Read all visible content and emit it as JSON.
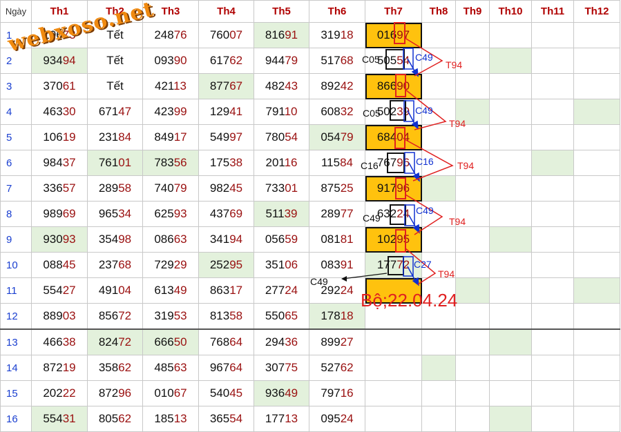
{
  "header": {
    "day": "Ngày",
    "months": [
      "Th1",
      "Th2",
      "Th3",
      "Th4",
      "Th5",
      "Th6",
      "Th7",
      "Th8",
      "Th9",
      "Th10",
      "Th11",
      "Th12"
    ]
  },
  "rows": [
    {
      "day": "1",
      "cells": [
        "10673",
        "Tết",
        "24876",
        "76007",
        "81691",
        "31918",
        "01697",
        "",
        "",
        "",
        "",
        ""
      ],
      "green": [
        4
      ]
    },
    {
      "day": "2",
      "cells": [
        "93494",
        "Tết",
        "09390",
        "61762",
        "94479",
        "51768",
        "50554",
        "",
        "",
        "",
        "",
        ""
      ],
      "green": [
        0,
        9
      ]
    },
    {
      "day": "3",
      "cells": [
        "37061",
        "Tết",
        "42113",
        "87767",
        "48243",
        "89242",
        "86690",
        "",
        "",
        "",
        "",
        ""
      ],
      "green": [
        3
      ]
    },
    {
      "day": "4",
      "cells": [
        "46330",
        "67147",
        "42399",
        "12941",
        "79110",
        "60832",
        "50239",
        "",
        "",
        "",
        "",
        ""
      ],
      "green": [
        8,
        11
      ]
    },
    {
      "day": "5",
      "cells": [
        "10619",
        "23184",
        "84917",
        "54997",
        "78054",
        "05479",
        "68404",
        "",
        "",
        "",
        "",
        ""
      ],
      "green": [
        5
      ]
    },
    {
      "day": "6",
      "cells": [
        "98437",
        "76101",
        "78356",
        "17538",
        "20116",
        "11584",
        "76796",
        "",
        "",
        "",
        "",
        ""
      ],
      "green": [
        1,
        2,
        10
      ]
    },
    {
      "day": "7",
      "cells": [
        "33657",
        "28958",
        "74079",
        "98245",
        "73301",
        "87525",
        "91796",
        "",
        "",
        "",
        "",
        ""
      ],
      "green": [
        7
      ]
    },
    {
      "day": "8",
      "cells": [
        "98969",
        "96534",
        "62593",
        "43769",
        "51139",
        "28977",
        "63224",
        "",
        "",
        "",
        "",
        ""
      ],
      "green": [
        4
      ]
    },
    {
      "day": "9",
      "cells": [
        "93093",
        "35498",
        "08663",
        "34194",
        "05659",
        "08181",
        "10295",
        "",
        "",
        "",
        "",
        ""
      ],
      "green": [
        0,
        9
      ]
    },
    {
      "day": "10",
      "cells": [
        "08845",
        "23768",
        "72929",
        "25295",
        "35106",
        "08391",
        "17772",
        "",
        "",
        "",
        "",
        ""
      ],
      "green": [
        3,
        6
      ]
    },
    {
      "day": "11",
      "cells": [
        "55427",
        "49104",
        "61349",
        "86317",
        "27724",
        "29224",
        "",
        "",
        "",
        "",
        "",
        ""
      ],
      "green": [
        8,
        11
      ]
    },
    {
      "day": "12",
      "cells": [
        "88903",
        "85672",
        "31953",
        "81358",
        "55065",
        "17818",
        "",
        "",
        "",
        "",
        "",
        ""
      ],
      "green": [
        5
      ]
    },
    {
      "day": "13",
      "cells": [
        "46638",
        "82472",
        "66650",
        "76864",
        "29436",
        "89927",
        "",
        "",
        "",
        "",
        "",
        ""
      ],
      "green": [
        1,
        2,
        9
      ]
    },
    {
      "day": "14",
      "cells": [
        "87219",
        "35862",
        "48563",
        "96764",
        "30775",
        "52762",
        "",
        "",
        "",
        "",
        "",
        ""
      ],
      "green": [
        7
      ]
    },
    {
      "day": "15",
      "cells": [
        "20222",
        "87296",
        "01067",
        "54045",
        "93649",
        "79716",
        "",
        "",
        "",
        "",
        "",
        ""
      ],
      "green": [
        4
      ]
    },
    {
      "day": "16",
      "cells": [
        "55431",
        "80562",
        "18513",
        "36554",
        "17713",
        "09524",
        "",
        "",
        "",
        "",
        "",
        ""
      ],
      "green": [
        0,
        9
      ]
    }
  ],
  "highlight": {
    "fill": "#ffc20e",
    "border": "#111111"
  },
  "watermark": "webxoso.net",
  "annotation": {
    "bo": "Bộ;22.04.24",
    "c05": "C05",
    "c49": "C49",
    "c16": "C16",
    "c27": "C27",
    "t94": "T94"
  }
}
